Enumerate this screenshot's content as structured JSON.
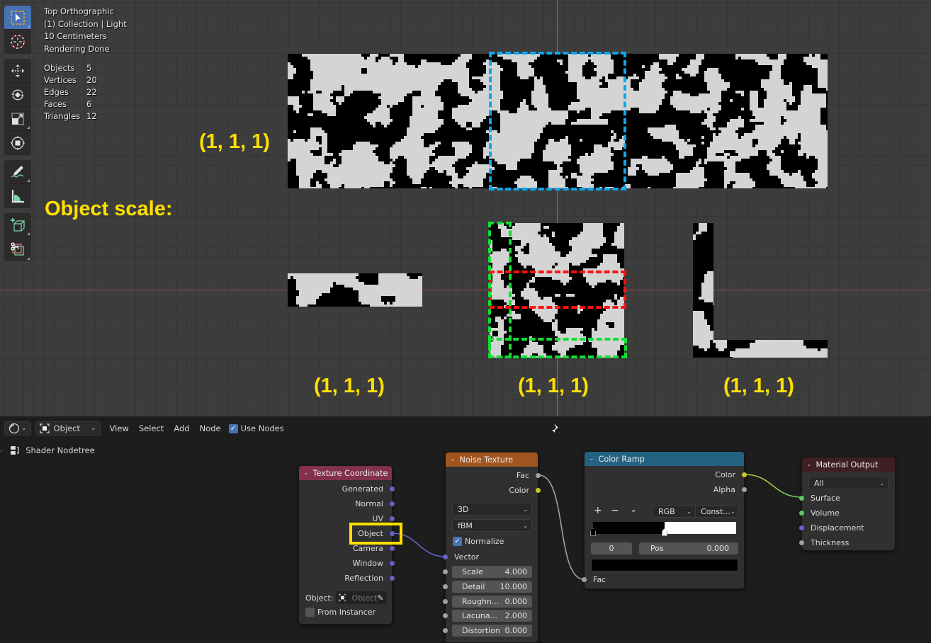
{
  "viewport": {
    "overlay": {
      "view_name": "Top Orthographic",
      "collection": "(1) Collection | Light",
      "grid_scale": "10 Centimeters",
      "render_status": "Rendering Done"
    },
    "stats": [
      {
        "label": "Objects",
        "value": "5"
      },
      {
        "label": "Vertices",
        "value": "20"
      },
      {
        "label": "Edges",
        "value": "22"
      },
      {
        "label": "Faces",
        "value": "6"
      },
      {
        "label": "Triangles",
        "value": "12"
      }
    ],
    "toolbar": [
      {
        "name": "select-box",
        "active": true
      },
      {
        "name": "cursor"
      },
      {
        "name": "move"
      },
      {
        "name": "rotate"
      },
      {
        "name": "scale"
      },
      {
        "name": "transform"
      },
      {
        "name": "annotate"
      },
      {
        "name": "measure"
      },
      {
        "name": "add-cube"
      },
      {
        "name": "knife"
      }
    ],
    "annotations": {
      "heading": "Object scale:",
      "top_plane_scale": "(1, 1, 1)",
      "bottom_left_scale": "(1, 1, 1)",
      "bottom_center_scale": "(1, 1, 1)",
      "bottom_right_scale": "(1, 1, 1)"
    },
    "colors": {
      "annotation_text": "#ffe000",
      "blue_outline": "#0aa8f0",
      "red_outline": "#ff1010",
      "green_outline": "#10e030"
    }
  },
  "node_editor": {
    "header": {
      "editor_type_icon": "shader-editor-icon",
      "object_mode": "Object",
      "menus": [
        "View",
        "Select",
        "Add",
        "Node"
      ],
      "use_nodes_label": "Use Nodes",
      "use_nodes_checked": true
    },
    "breadcrumb": "Shader Nodetree",
    "nodes": {
      "texture_coordinate": {
        "title": "Texture Coordinate",
        "outputs": [
          "Generated",
          "Normal",
          "UV",
          "Object",
          "Camera",
          "Window",
          "Reflection"
        ],
        "highlighted_output": "Object",
        "object_label": "Object:",
        "object_placeholder": "Object",
        "from_instancer_label": "From Instancer",
        "from_instancer_checked": false
      },
      "noise_texture": {
        "title": "Noise Texture",
        "outputs": [
          "Fac",
          "Color"
        ],
        "dimensions": "3D",
        "type": "fBM",
        "normalize_label": "Normalize",
        "normalize_checked": true,
        "vector_input": "Vector",
        "inputs": [
          {
            "label": "Scale",
            "value": "4.000"
          },
          {
            "label": "Detail",
            "value": "10.000"
          },
          {
            "label": "Roughn...",
            "value": "0.000"
          },
          {
            "label": "Lacuna...",
            "value": "2.000"
          },
          {
            "label": "Distortion",
            "value": "0.000"
          }
        ]
      },
      "color_ramp": {
        "title": "Color Ramp",
        "outputs": [
          "Color",
          "Alpha"
        ],
        "add_label": "+",
        "remove_label": "−",
        "menu_label": "⌄",
        "color_mode": "RGB",
        "interpolation": "Const...",
        "stop_index": "0",
        "pos_label": "Pos",
        "pos_value": "0.000",
        "stops": [
          {
            "position": 0.0,
            "color": "#000000"
          },
          {
            "position": 0.5,
            "color": "#ffffff"
          }
        ],
        "input": "Fac"
      },
      "material_output": {
        "title": "Material Output",
        "target": "All",
        "inputs": [
          "Surface",
          "Volume",
          "Displacement",
          "Thickness"
        ]
      }
    }
  }
}
